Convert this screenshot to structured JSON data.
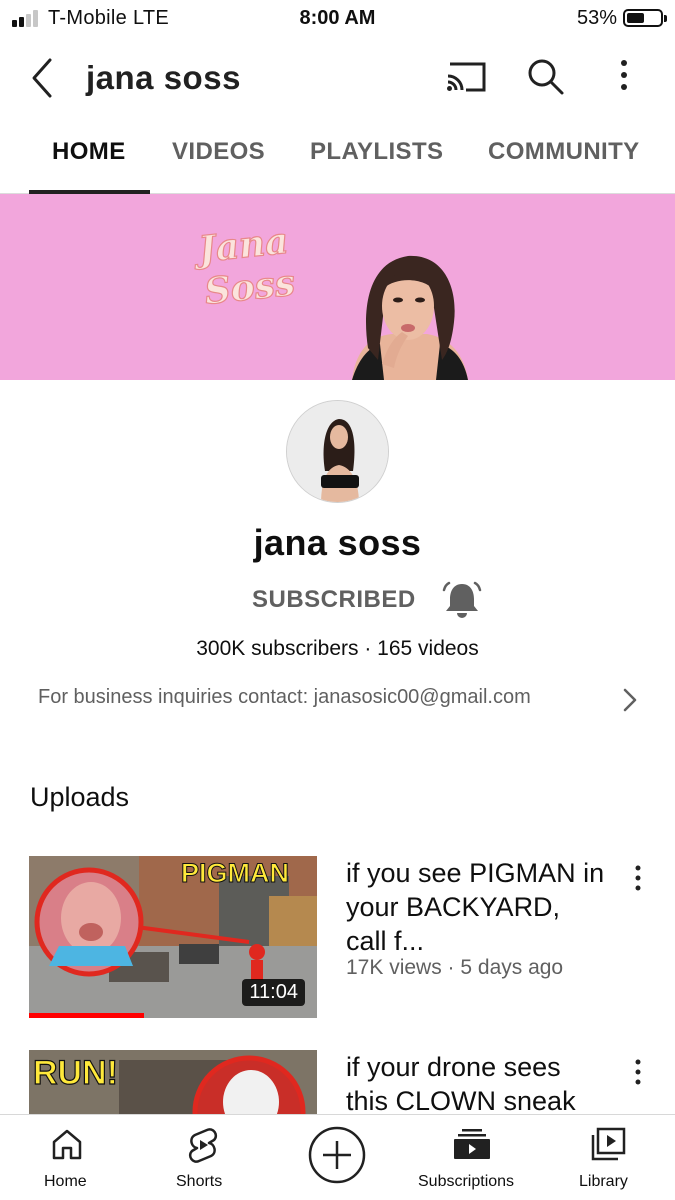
{
  "status_bar": {
    "carrier": "T-Mobile  LTE",
    "time": "8:00 AM",
    "battery": "53%",
    "battery_level": 0.53,
    "signal_bars_active": 2
  },
  "app_bar": {
    "title": "jana soss",
    "back_icon": "back-chevron-icon",
    "cast_icon": "cast-icon",
    "search_icon": "search-icon",
    "more_icon": "more-vertical-icon"
  },
  "tabs": [
    {
      "label": "HOME",
      "active": true
    },
    {
      "label": "VIDEOS",
      "active": false
    },
    {
      "label": "PLAYLISTS",
      "active": false
    },
    {
      "label": "COMMUNITY",
      "active": false
    }
  ],
  "banner": {
    "logo_line1": "Jana",
    "logo_line2": "Soss",
    "color": "#f2a6dc"
  },
  "channel": {
    "name": "jana soss",
    "subscribe_label": "SUBSCRIBED",
    "bell_icon": "notification-bell-icon",
    "stats": "300K subscribers · 165 videos",
    "description": "For business inquiries contact: janasosic00@gmail.com"
  },
  "uploads": {
    "heading": "Uploads",
    "videos": [
      {
        "title": "if you see PIGMAN in your BACKYARD, call f...",
        "meta": "17K views · 5 days ago",
        "duration": "11:04",
        "thumb_caption": "PIGMAN",
        "watched_fraction": 0.4
      },
      {
        "title": "if your drone sees this CLOWN sneak",
        "meta": "",
        "duration": "",
        "thumb_caption": "RUN!",
        "watched_fraction": 0
      }
    ]
  },
  "bottom_nav": [
    {
      "label": "Home",
      "icon": "home-icon"
    },
    {
      "label": "Shorts",
      "icon": "shorts-icon"
    },
    {
      "label": "",
      "icon": "create-plus-icon"
    },
    {
      "label": "Subscriptions",
      "icon": "subscriptions-icon"
    },
    {
      "label": "Library",
      "icon": "library-icon"
    }
  ],
  "colors": {
    "accent_red": "#ff0000",
    "banner_pink": "#f2a6dc",
    "thumb_caption_yellow": "#ffe93b",
    "secondary_text": "#606060"
  }
}
